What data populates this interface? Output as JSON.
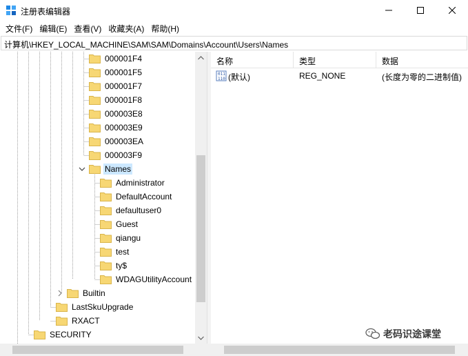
{
  "window": {
    "title": "注册表编辑器",
    "minimize_icon": "minimize-icon",
    "maximize_icon": "maximize-icon",
    "close_icon": "close-icon"
  },
  "menu": [
    {
      "label": "文件(F)"
    },
    {
      "label": "编辑(E)"
    },
    {
      "label": "查看(V)"
    },
    {
      "label": "收藏夹(A)"
    },
    {
      "label": "帮助(H)"
    }
  ],
  "address": "计算机\\HKEY_LOCAL_MACHINE\\SAM\\SAM\\Domains\\Account\\Users\\Names",
  "tree": {
    "user_keys": [
      "000001F4",
      "000001F5",
      "000001F7",
      "000001F8",
      "000003E8",
      "000003E9",
      "000003EA",
      "000003F9"
    ],
    "names_key": "Names",
    "names_children": [
      "Administrator",
      "DefaultAccount",
      "defaultuser0",
      "Guest",
      "qiangu",
      "test",
      "ty$",
      "WDAGUtilityAccount"
    ],
    "builtin": "Builtin",
    "last_sku": "LastSkuUpgrade",
    "rxact": "RXACT",
    "security": "SECURITY"
  },
  "list": {
    "columns": {
      "name": "名称",
      "type": "类型",
      "data": "数据"
    },
    "rows": [
      {
        "name": "(默认)",
        "type": "REG_NONE",
        "data": "(长度为零的二进制值)"
      }
    ]
  },
  "watermark": {
    "text": "老码识途课堂",
    "icon": "wechat-icon"
  },
  "colors": {
    "folder": "#f7d774",
    "folder_edge": "#d9b44a",
    "selection": "#cce8ff",
    "scroll_thumb": "#cdcdcd"
  }
}
